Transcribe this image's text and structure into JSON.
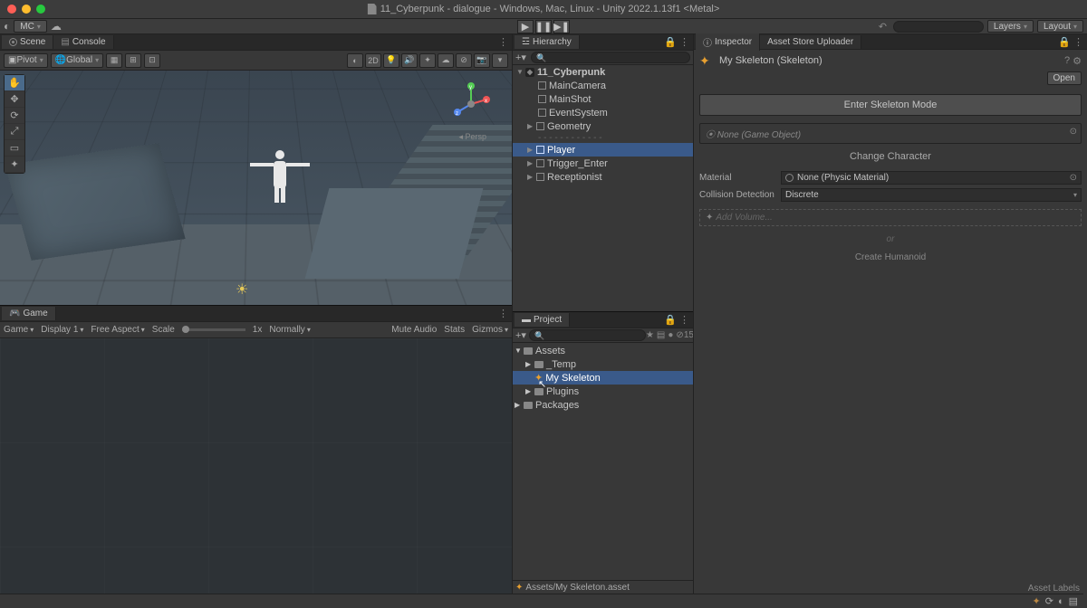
{
  "title": "11_Cyberpunk - dialogue - Windows, Mac, Linux - Unity 2022.1.13f1 <Metal>",
  "topbar": {
    "mc": "MC",
    "search_placeholder": "",
    "layers": "Layers",
    "layout": "Layout"
  },
  "sceneTab": "Scene",
  "consoleTab": "Console",
  "sceneToolbar": {
    "pivot": "Pivot",
    "global": "Global",
    "mode2d": "2D",
    "persp": "Persp"
  },
  "gameTab": "Game",
  "gameToolbar": {
    "game": "Game",
    "display": "Display 1",
    "aspect": "Free Aspect",
    "scale": "Scale",
    "scaleVal": "1x",
    "normally": "Normally",
    "muteAudio": "Mute Audio",
    "stats": "Stats",
    "gizmos": "Gizmos"
  },
  "hierarchyTab": "Hierarchy",
  "hierarchy": {
    "root": "11_Cyberpunk",
    "items": [
      "MainCamera",
      "MainShot",
      "EventSystem",
      "Geometry",
      "Player",
      "Trigger_Enter",
      "Receptionist"
    ]
  },
  "projectTab": "Project",
  "project": {
    "assets": "Assets",
    "items": [
      "_Temp",
      "My Skeleton",
      "Plugins"
    ],
    "packages": "Packages",
    "count": "15",
    "footer": "Assets/My Skeleton.asset"
  },
  "inspector": {
    "tab1": "Inspector",
    "tab2": "Asset Store Uploader",
    "name": "My Skeleton (Skeleton)",
    "open": "Open",
    "enterMode": "Enter Skeleton Mode",
    "noneGO": "None (Game Object)",
    "changeChar": "Change Character",
    "material": "Material",
    "materialVal": "None (Physic Material)",
    "collision": "Collision Detection",
    "collisionVal": "Discrete",
    "addVolume": "Add Volume...",
    "or": "or",
    "createHumanoid": "Create Humanoid",
    "assetLabels": "Asset Labels"
  }
}
